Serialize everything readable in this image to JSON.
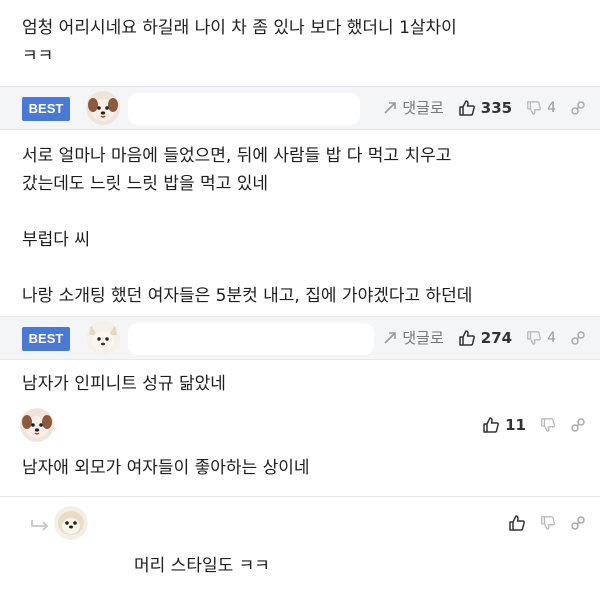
{
  "comment_top": {
    "text": "엄청 어리시네요 하길래 나이 차 좀 있나 보다 했더니 1살차이\nㅋㅋ"
  },
  "best1": {
    "badge": "BEST",
    "reply_label": "댓글로",
    "likes": "335",
    "dislikes": "4",
    "text": "서로 얼마나 마음에 들었으면, 뒤에 사람들 밥 다 먹고 치우고\n갔는데도 느릿 느릿 밥을 먹고 있네\n\n부럽다 씨\n\n나랑 소개팅 했던 여자들은 5분컷 내고, 집에 가야겠다고 하던데"
  },
  "best2": {
    "badge": "BEST",
    "reply_label": "댓글로",
    "likes": "274",
    "dislikes": "4",
    "text": "남자가 인피니트 성규 닮았네"
  },
  "comment3": {
    "likes": "11",
    "text": "남자애 외모가 여자들이 좋아하는 상이네"
  },
  "reply1": {
    "text": "머리 스타일도 ㅋㅋ"
  },
  "icons": {
    "reply": "reply-arrow-icon",
    "like": "thumbs-up-icon",
    "dislike": "thumbs-down-icon",
    "link": "link-icon",
    "nested": "nested-reply-arrow-icon"
  },
  "colors": {
    "best_badge": "#4a78d6",
    "bar_bg": "#f4f5f7"
  }
}
